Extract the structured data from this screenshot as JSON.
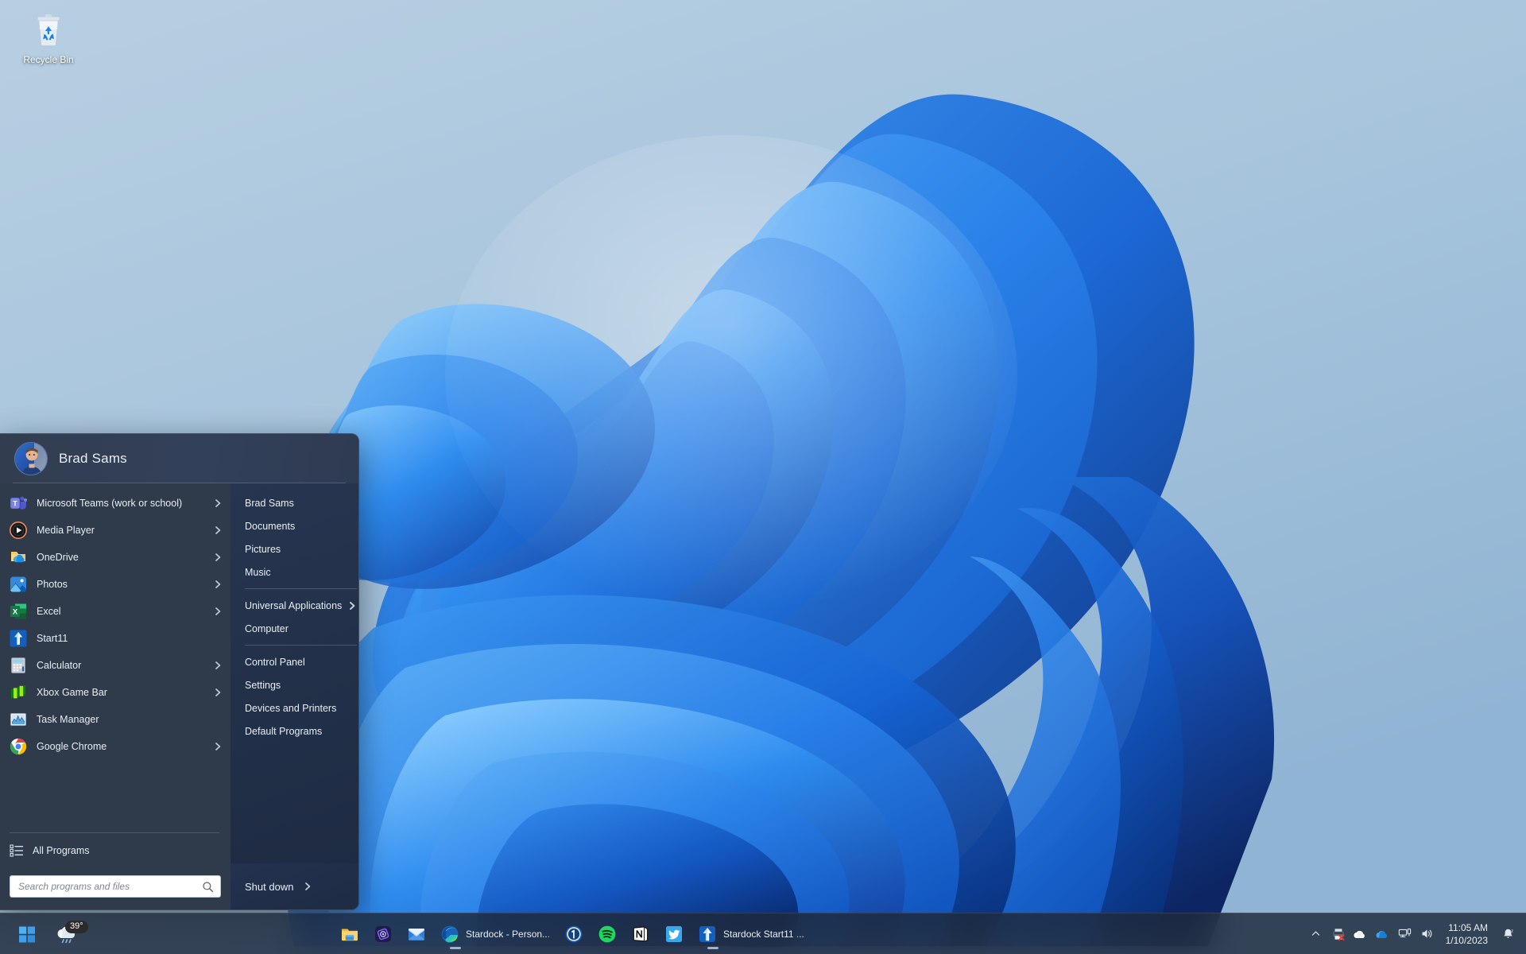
{
  "desktop": {
    "icons": [
      {
        "name": "Recycle Bin",
        "icon": "recycle-bin-icon"
      }
    ],
    "wallpaper_colors": {
      "sky_top": "#b4cde0",
      "sky_bottom": "#93b6d4",
      "bloom_light": "#4aa3f0",
      "bloom_mid": "#1d6fd8",
      "bloom_dark": "#0b3f9e",
      "bloom_deep": "#07276b"
    }
  },
  "start_menu": {
    "user": {
      "name": "Brad Sams",
      "avatar": "user-avatar"
    },
    "left_items": [
      {
        "label": "Microsoft Teams (work or school)",
        "icon": "microsoft-teams-icon",
        "has_submenu": true
      },
      {
        "label": "Media Player",
        "icon": "media-player-icon",
        "has_submenu": true
      },
      {
        "label": "OneDrive",
        "icon": "onedrive-icon",
        "has_submenu": true
      },
      {
        "label": "Photos",
        "icon": "photos-icon",
        "has_submenu": true
      },
      {
        "label": "Excel",
        "icon": "excel-icon",
        "has_submenu": true
      },
      {
        "label": "Start11",
        "icon": "start11-icon",
        "has_submenu": false
      },
      {
        "label": "Calculator",
        "icon": "calculator-icon",
        "has_submenu": true
      },
      {
        "label": "Xbox Game Bar",
        "icon": "xbox-game-bar-icon",
        "has_submenu": true
      },
      {
        "label": "Task Manager",
        "icon": "task-manager-icon",
        "has_submenu": false
      },
      {
        "label": "Google Chrome",
        "icon": "google-chrome-icon",
        "has_submenu": true
      }
    ],
    "all_programs": {
      "label": "All Programs",
      "icon": "all-programs-list-icon"
    },
    "right_items": [
      {
        "label": "Brad Sams",
        "has_submenu": false
      },
      {
        "label": "Documents",
        "has_submenu": false
      },
      {
        "label": "Pictures",
        "has_submenu": false
      },
      {
        "label": "Music",
        "has_submenu": false
      },
      {
        "separator_after": true,
        "label": "__sep1__"
      },
      {
        "label": "Universal Applications",
        "has_submenu": true
      },
      {
        "label": "Computer",
        "has_submenu": false
      },
      {
        "separator_after": true,
        "label": "__sep2__"
      },
      {
        "label": "Control Panel",
        "has_submenu": false
      },
      {
        "label": "Settings",
        "has_submenu": false
      },
      {
        "label": "Devices and Printers",
        "has_submenu": false
      },
      {
        "label": "Default Programs",
        "has_submenu": false
      }
    ],
    "search": {
      "value": "",
      "placeholder": "Search programs and files",
      "icon": "search-icon"
    },
    "shutdown": {
      "label": "Shut down",
      "has_submenu": true
    },
    "colors": {
      "left_panel": "#2f3a4b",
      "right_panel": "#223049",
      "text": "#e9eef5"
    }
  },
  "taskbar": {
    "start_button": {
      "name": "start-button",
      "icon": "windows-logo-icon"
    },
    "weather": {
      "temperature": "39°",
      "icon": "rain-cloud-icon"
    },
    "pinned": [
      {
        "label": "",
        "icon": "file-explorer-icon",
        "running": false
      },
      {
        "label": "",
        "icon": "microsoft-loop-icon",
        "running": false
      },
      {
        "label": "",
        "icon": "mail-icon",
        "running": false
      },
      {
        "label": "Stardock - Person...",
        "icon": "microsoft-edge-icon",
        "running": true
      },
      {
        "label": "",
        "icon": "1password-icon",
        "running": false
      },
      {
        "label": "",
        "icon": "spotify-icon",
        "running": false
      },
      {
        "label": "",
        "icon": "notion-icon",
        "running": false
      },
      {
        "label": "",
        "icon": "twitter-icon",
        "running": false
      },
      {
        "label": "Stardock Start11 ...",
        "icon": "start11-icon",
        "running": true
      }
    ],
    "tray": [
      {
        "icon": "chevron-up-icon",
        "name": "show-hidden-icons"
      },
      {
        "icon": "printer-offline-icon",
        "name": "printer-status"
      },
      {
        "icon": "onedrive-personal-icon",
        "name": "onedrive-personal"
      },
      {
        "icon": "onedrive-business-icon",
        "name": "onedrive-business"
      },
      {
        "icon": "network-icon",
        "name": "network-status"
      },
      {
        "icon": "volume-icon",
        "name": "volume-status"
      }
    ],
    "clock": {
      "time": "11:05 AM",
      "date": "1/10/2023"
    },
    "notifications": {
      "icon": "notification-bell-icon"
    }
  }
}
